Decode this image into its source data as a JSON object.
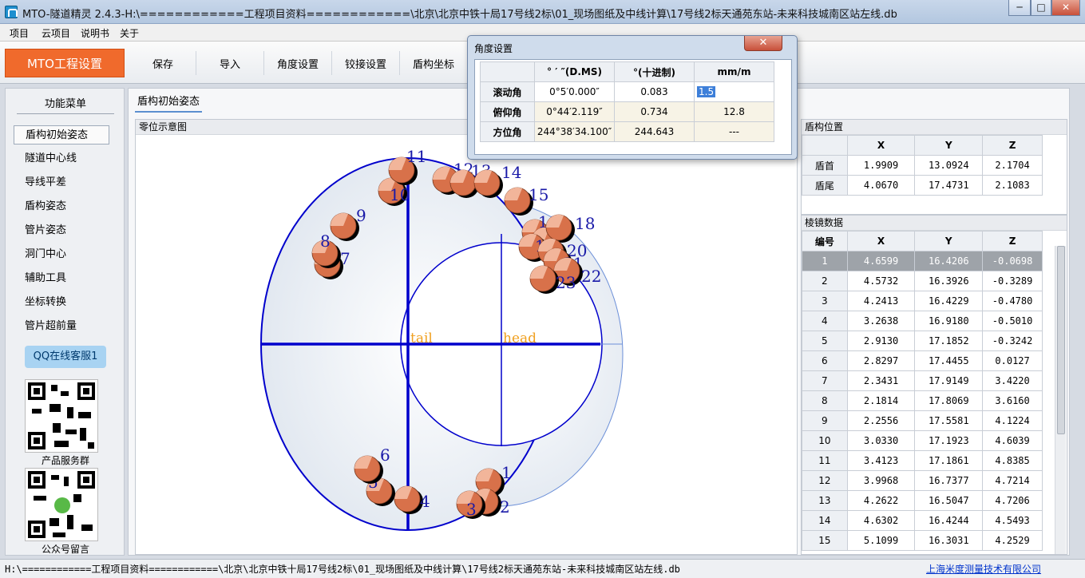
{
  "window": {
    "title": "MTO-隧道精灵 2.4.3-H:\\============工程项目资料============\\北京\\北京中铁十局17号线2标\\01_现场图纸及中线计算\\17号线2标天通苑东站-未来科技城南区站左线.db",
    "min_label": "─",
    "max_label": "□",
    "close_label": "✕"
  },
  "menu": {
    "items": [
      "项目",
      "云项目",
      "说明书",
      "关于"
    ]
  },
  "toolbar": {
    "primary": "MTO工程设置",
    "buttons": [
      "保存",
      "导入",
      "角度设置",
      "铰接设置",
      "盾构坐标"
    ]
  },
  "sidebar": {
    "title": "功能菜单",
    "items": [
      "盾构初始姿态",
      "隧道中心线",
      "导线平差",
      "盾构姿态",
      "管片姿态",
      "洞门中心",
      "辅助工具",
      "坐标转换",
      "管片超前量"
    ],
    "active_index": 0,
    "qq_label": "QQ在线客服1",
    "qr1_label": "产品服务群",
    "qr2_label": "公众号留言"
  },
  "main": {
    "tab": "盾构初始姿态",
    "diagram_caption": "零位示意图",
    "label_tail": "tail",
    "label_head": "head"
  },
  "diagram_points": [
    {
      "n": "1"
    },
    {
      "n": "2"
    },
    {
      "n": "3"
    },
    {
      "n": "4"
    },
    {
      "n": "5"
    },
    {
      "n": "6"
    },
    {
      "n": "7"
    },
    {
      "n": "8"
    },
    {
      "n": "9"
    },
    {
      "n": "10"
    },
    {
      "n": "11"
    },
    {
      "n": "12"
    },
    {
      "n": "13"
    },
    {
      "n": "14"
    },
    {
      "n": "15"
    },
    {
      "n": "16"
    },
    {
      "n": "17"
    },
    {
      "n": "18"
    },
    {
      "n": "19"
    },
    {
      "n": "20"
    },
    {
      "n": "21"
    },
    {
      "n": "22"
    },
    {
      "n": "23"
    }
  ],
  "shield_position": {
    "caption": "盾构位置",
    "headers": [
      "",
      "X",
      "Y",
      "Z"
    ],
    "rows": [
      [
        "盾首",
        "1.9909",
        "13.0924",
        "2.1704"
      ],
      [
        "盾尾",
        "4.0670",
        "17.4731",
        "2.1083"
      ]
    ]
  },
  "prism_data": {
    "caption": "棱镜数据",
    "headers": [
      "编号",
      "X",
      "Y",
      "Z"
    ],
    "selected_index": 0,
    "rows": [
      [
        "1",
        "4.6599",
        "16.4206",
        "-0.0698"
      ],
      [
        "2",
        "4.5732",
        "16.3926",
        "-0.3289"
      ],
      [
        "3",
        "4.2413",
        "16.4229",
        "-0.4780"
      ],
      [
        "4",
        "3.2638",
        "16.9180",
        "-0.5010"
      ],
      [
        "5",
        "2.9130",
        "17.1852",
        "-0.3242"
      ],
      [
        "6",
        "2.8297",
        "17.4455",
        "0.0127"
      ],
      [
        "7",
        "2.3431",
        "17.9149",
        "3.4220"
      ],
      [
        "8",
        "2.1814",
        "17.8069",
        "3.6160"
      ],
      [
        "9",
        "2.2556",
        "17.5581",
        "4.1224"
      ],
      [
        "10",
        "3.0330",
        "17.1923",
        "4.6039"
      ],
      [
        "11",
        "3.4123",
        "17.1861",
        "4.8385"
      ],
      [
        "12",
        "3.9968",
        "16.7377",
        "4.7214"
      ],
      [
        "13",
        "4.2622",
        "16.5047",
        "4.7206"
      ],
      [
        "14",
        "4.6302",
        "16.4244",
        "4.5493"
      ],
      [
        "15",
        "5.1099",
        "16.3031",
        "4.2529"
      ]
    ]
  },
  "angle_dialog": {
    "title": "角度设置",
    "close_label": "✕",
    "headers": [
      "",
      "° ′ ″(D.MS)",
      "°(十进制)",
      "mm/m"
    ],
    "rows": [
      [
        "滚动角",
        "0°5′0.000″",
        "0.083",
        "1.5"
      ],
      [
        "俯仰角",
        "0°44′2.119″",
        "0.734",
        "12.8"
      ],
      [
        "方位角",
        "244°38′34.100″",
        "244.643",
        "---"
      ]
    ]
  },
  "status": {
    "path": "H:\\============工程项目资料============\\北京\\北京中铁十局17号线2标\\01_现场图纸及中线计算\\17号线2标天通苑东站-未来科技城南区站左线.db",
    "company": "上海米度测量技术有限公司"
  }
}
